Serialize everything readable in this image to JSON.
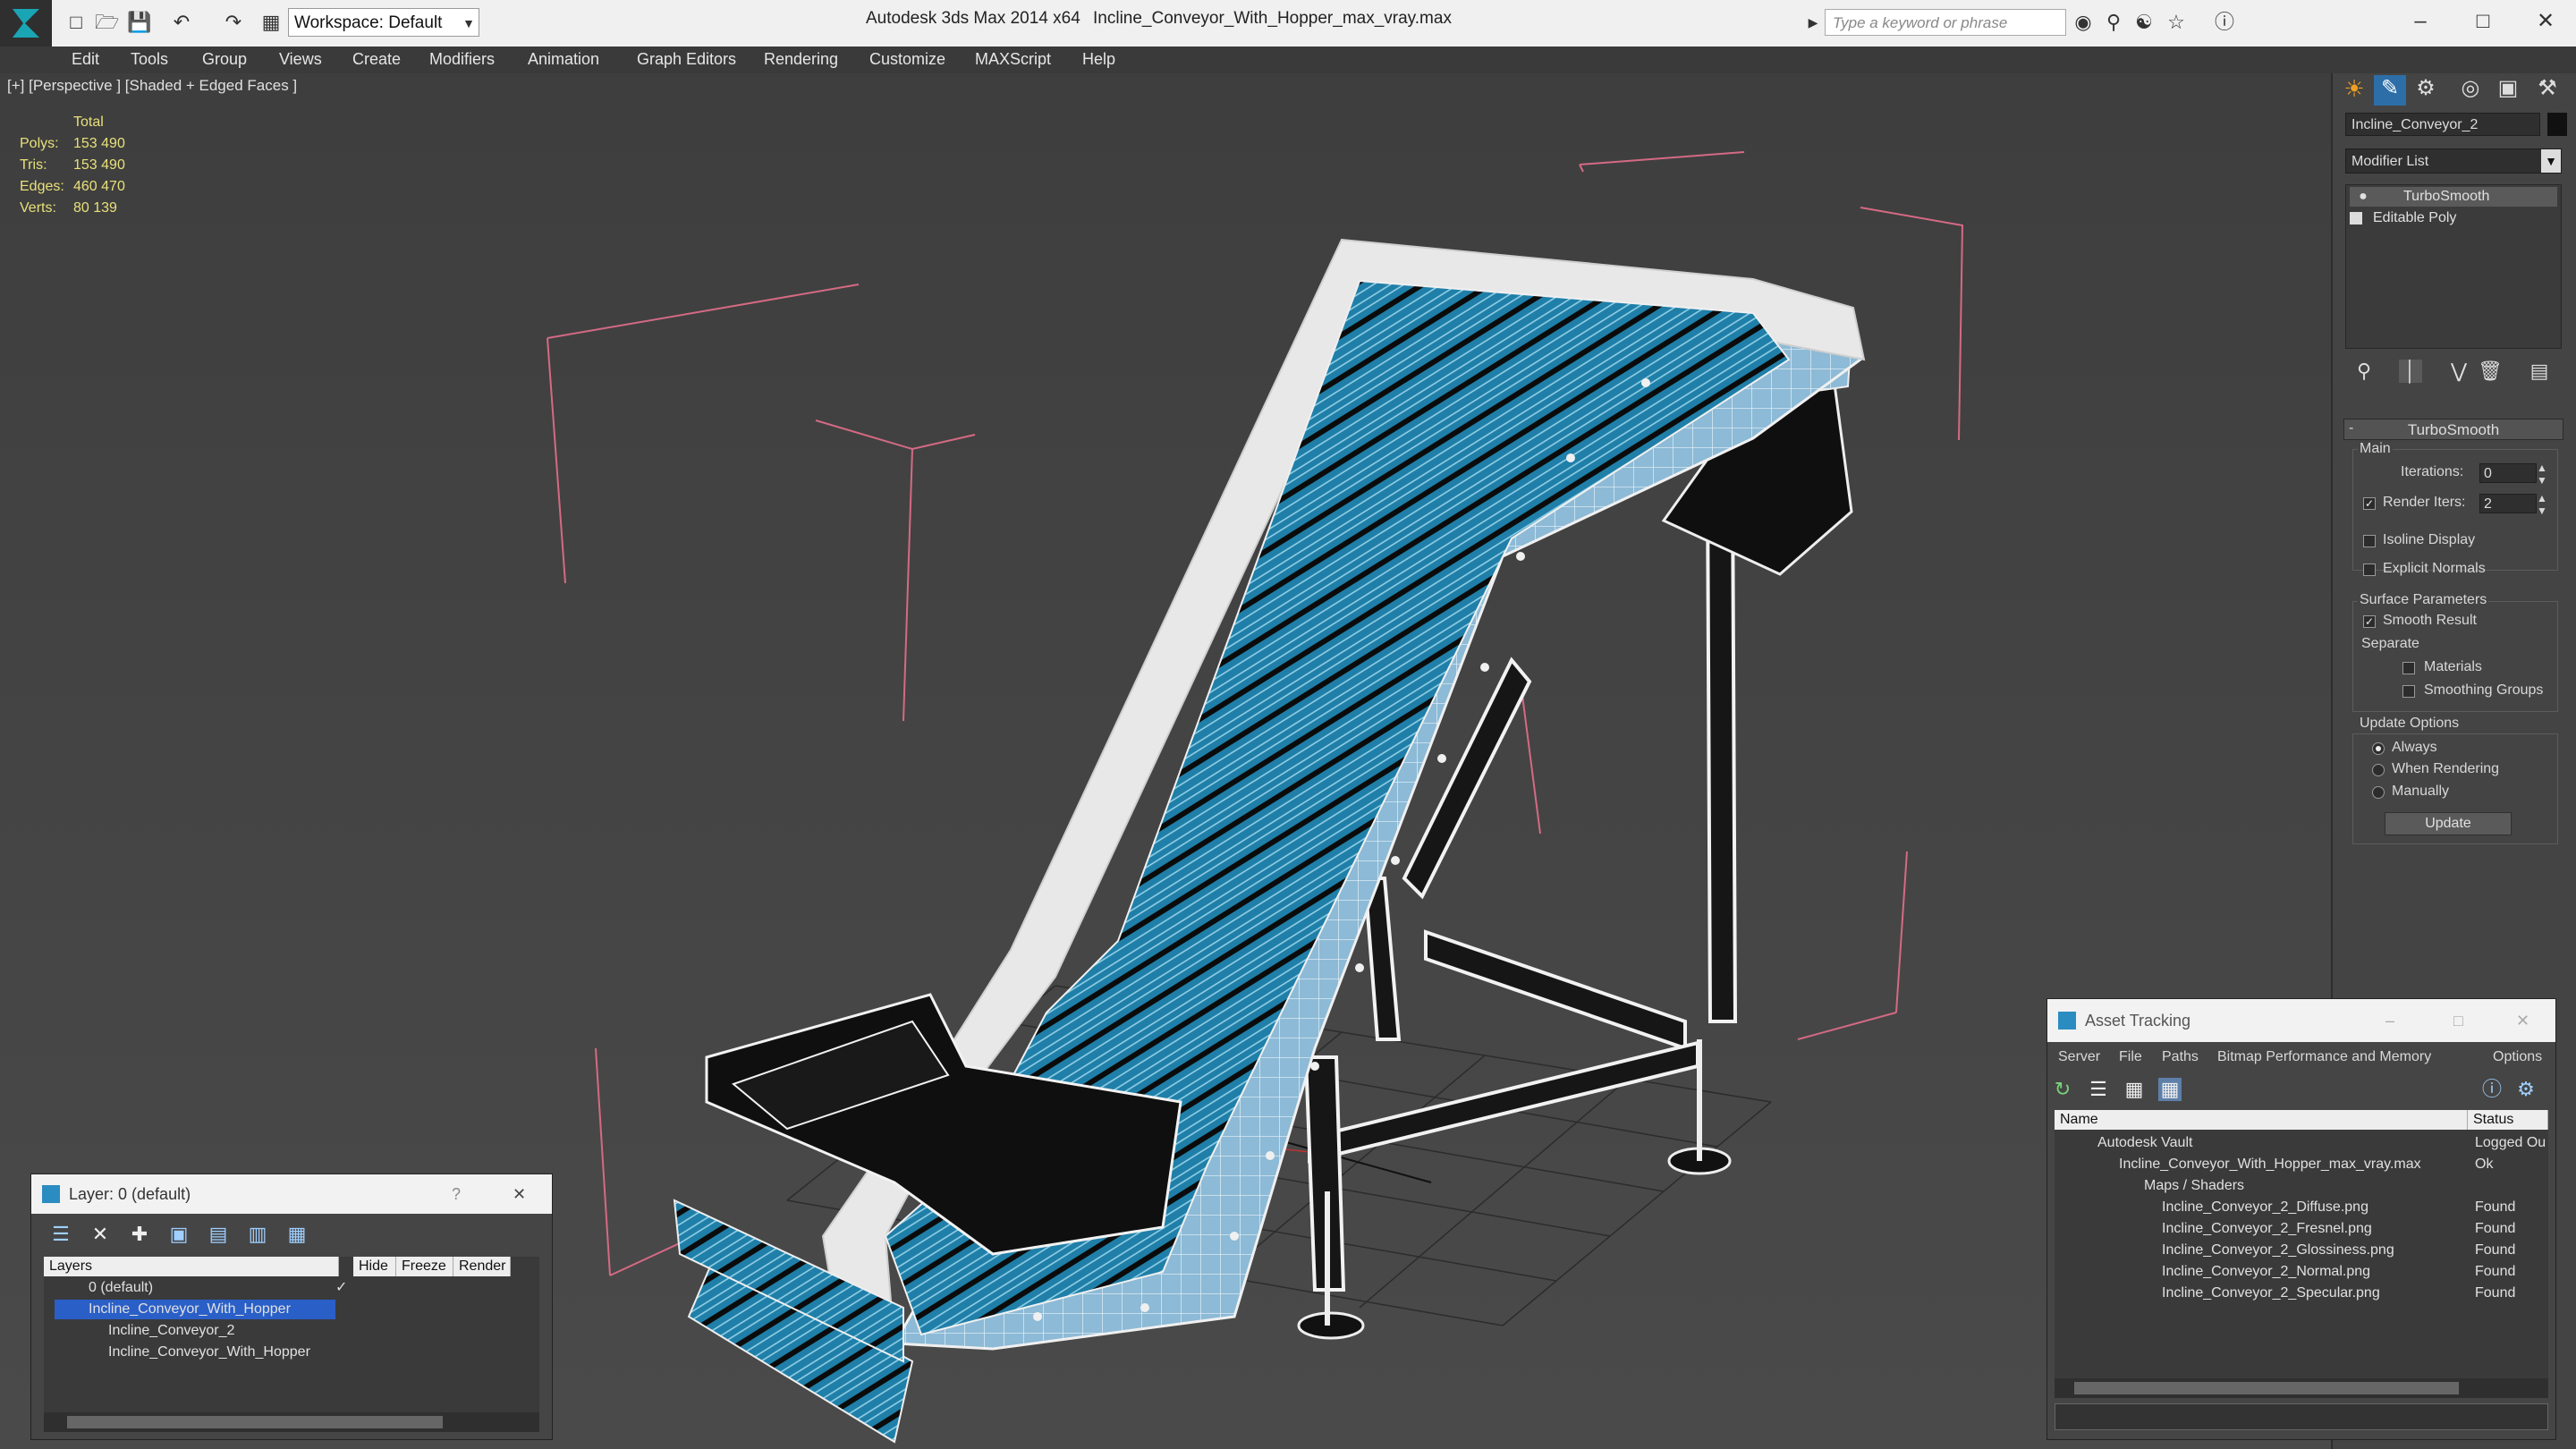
{
  "titlebar": {
    "workspace": "Workspace: Default",
    "app_title": "Autodesk 3ds Max  2014 x64",
    "file_title": "Incline_Conveyor_With_Hopper_max_vray.max",
    "search_placeholder": "Type a keyword or phrase"
  },
  "menu": [
    "Edit",
    "Tools",
    "Group",
    "Views",
    "Create",
    "Modifiers",
    "Animation",
    "Graph Editors",
    "Rendering",
    "Customize",
    "MAXScript",
    "Help"
  ],
  "viewport": {
    "label": "[+] [Perspective ] [Shaded + Edged Faces ]",
    "stats": {
      "header": "Total",
      "rows": [
        {
          "label": "Polys:",
          "value": "153 490"
        },
        {
          "label": "Tris:",
          "value": "153 490"
        },
        {
          "label": "Edges:",
          "value": "460 470"
        },
        {
          "label": "Verts:",
          "value": "80 139"
        }
      ]
    }
  },
  "command_panel": {
    "object_name": "Incline_Conveyor_2",
    "modifier_list": "Modifier List",
    "stack": [
      "TurboSmooth",
      "Editable Poly"
    ],
    "rollout_title": "TurboSmooth",
    "main_group": "Main",
    "iterations_label": "Iterations:",
    "iterations_value": "0",
    "render_iters_label": "Render Iters:",
    "render_iters_value": "2",
    "isoline_display": "Isoline Display",
    "explicit_normals": "Explicit Normals",
    "surface_group": "Surface Parameters",
    "smooth_result": "Smooth Result",
    "separate": "Separate",
    "materials": "Materials",
    "smoothing_groups": "Smoothing Groups",
    "update_group": "Update Options",
    "always": "Always",
    "when_rendering": "When Rendering",
    "manually": "Manually",
    "update_button": "Update"
  },
  "layer_window": {
    "title": "Layer: 0 (default)",
    "help": "?",
    "columns": [
      "Layers",
      "Hide",
      "Freeze",
      "Render"
    ],
    "rows": [
      "0 (default)",
      "Incline_Conveyor_With_Hopper",
      "Incline_Conveyor_2",
      "Incline_Conveyor_With_Hopper"
    ]
  },
  "asset_window": {
    "title": "Asset Tracking",
    "menu": [
      "Server",
      "File",
      "Paths",
      "Bitmap Performance and Memory",
      "Options"
    ],
    "columns": [
      "Name",
      "Status"
    ],
    "rows": [
      {
        "name": "Autodesk Vault",
        "status": "Logged Ou"
      },
      {
        "name": "Incline_Conveyor_With_Hopper_max_vray.max",
        "status": "Ok"
      },
      {
        "name": "Maps / Shaders",
        "status": ""
      },
      {
        "name": "Incline_Conveyor_2_Diffuse.png",
        "status": "Found"
      },
      {
        "name": "Incline_Conveyor_2_Fresnel.png",
        "status": "Found"
      },
      {
        "name": "Incline_Conveyor_2_Glossiness.png",
        "status": "Found"
      },
      {
        "name": "Incline_Conveyor_2_Normal.png",
        "status": "Found"
      },
      {
        "name": "Incline_Conveyor_2_Specular.png",
        "status": "Found"
      }
    ]
  }
}
